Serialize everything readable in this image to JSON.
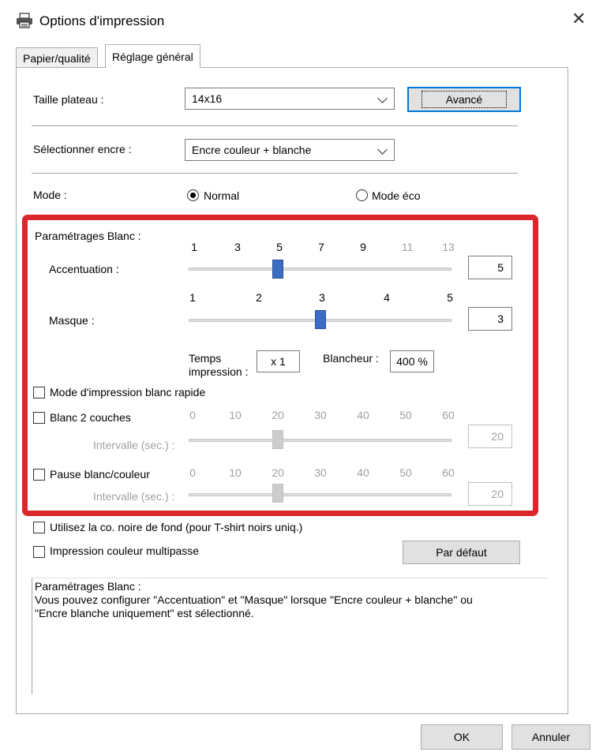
{
  "window": {
    "title": "Options d'impression",
    "close_glyph": "✕"
  },
  "tabs": [
    {
      "label": "Papier/qualité",
      "active": false
    },
    {
      "label": "Réglage général",
      "active": true
    }
  ],
  "taille_plateau": {
    "label": "Taille plateau :",
    "value": "14x16",
    "button": "Avancé"
  },
  "encre": {
    "label": "Sélectionner encre :",
    "value": "Encre couleur + blanche"
  },
  "mode": {
    "label": "Mode :",
    "options": [
      "Normal",
      "Mode éco"
    ],
    "selected": "Normal"
  },
  "blanc": {
    "title": "Paramétrages Blanc :",
    "accentuation": {
      "label": "Accentuation :",
      "ticks": [
        "1",
        "3",
        "5",
        "7",
        "9",
        "11",
        "13"
      ],
      "value": "5",
      "min": 1,
      "max": 13
    },
    "masque": {
      "label": "Masque :",
      "ticks": [
        "1",
        "2",
        "3",
        "4",
        "5"
      ],
      "value": "3",
      "min": 1,
      "max": 5
    },
    "temps_label_1": "Temps",
    "temps_label_2": "impression :",
    "temps_value": "x 1",
    "blancheur_label": "Blancheur :",
    "blancheur_value": "400 %",
    "rapide_label": "Mode d'impression blanc rapide",
    "deux_couches": {
      "label": "Blanc 2 couches",
      "interval_label": "Intervalle (sec.) :",
      "ticks": [
        "0",
        "10",
        "20",
        "30",
        "40",
        "50",
        "60"
      ],
      "value": "20",
      "min": 0,
      "max": 60
    },
    "pause": {
      "label": "Pause blanc/couleur",
      "interval_label": "Intervalle (sec.) :",
      "ticks": [
        "0",
        "10",
        "20",
        "30",
        "40",
        "50",
        "60"
      ],
      "value": "20",
      "min": 0,
      "max": 60
    }
  },
  "options": {
    "noire_fond": "Utilisez la co. noire de fond (pour T-shirt noirs uniq.)",
    "multipasse": "Impression couleur multipasse",
    "default_button": "Par défaut"
  },
  "info": {
    "title": "Paramétrages Blanc :",
    "line1": "Vous pouvez configurer \"Accentuation\" et \"Masque\" lorsque \"Encre couleur + blanche\" ou",
    "line2": "\"Encre blanche uniquement\" est sélectionné."
  },
  "footer": {
    "ok": "OK",
    "cancel": "Annuler"
  },
  "colors": {
    "accent": "#d9272d",
    "thumb": "#3d6cc3"
  }
}
